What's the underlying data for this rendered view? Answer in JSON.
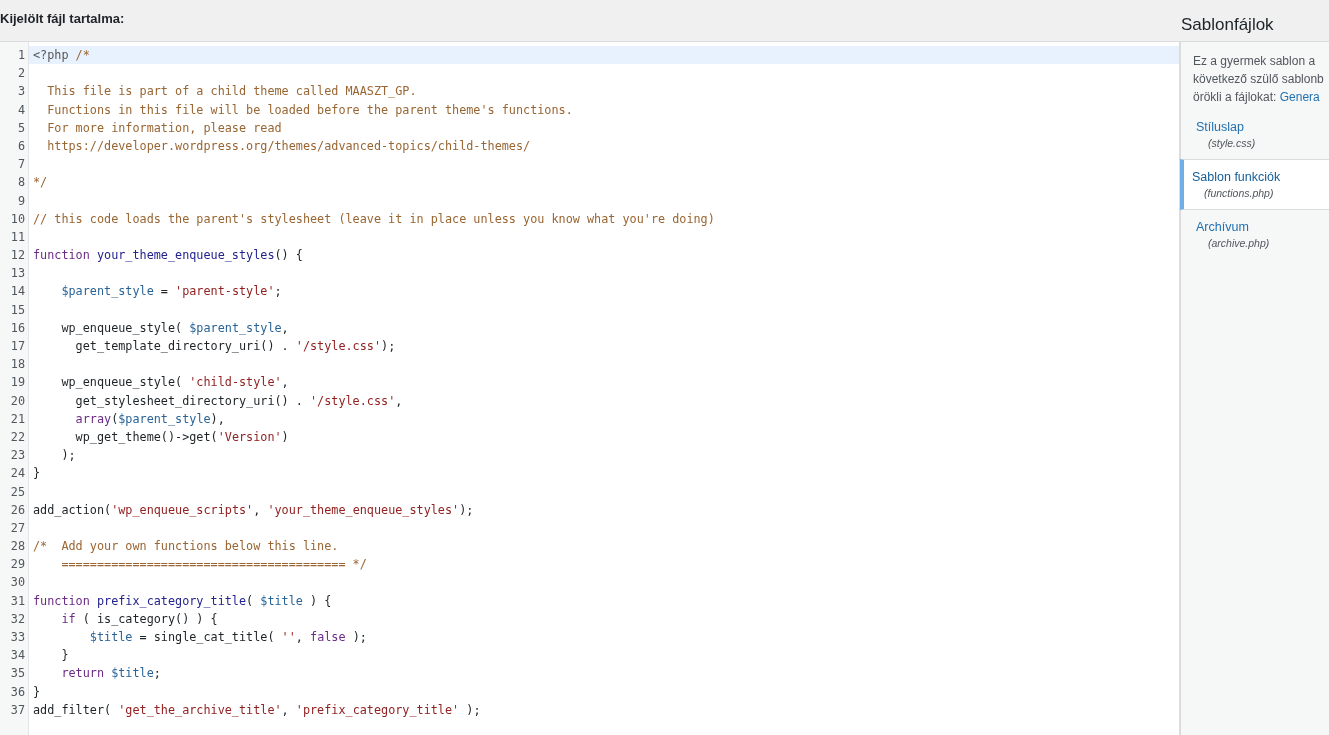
{
  "editor": {
    "label": "Kijelölt fájl tartalma:",
    "lines": [
      {
        "number": "1",
        "current": true,
        "tokens": [
          {
            "kind": "meta",
            "text": "<?php"
          },
          {
            "kind": "comment",
            "text": " /*"
          }
        ]
      },
      {
        "number": "2",
        "current": false
      },
      {
        "number": "3",
        "current": false,
        "tokens": [
          {
            "kind": "comment",
            "text": "  This file is part of a child theme called MAASZT_GP."
          }
        ]
      },
      {
        "number": "4",
        "current": false,
        "tokens": [
          {
            "kind": "comment",
            "text": "  Functions in this file will be loaded before the parent theme's functions."
          }
        ]
      },
      {
        "number": "5",
        "current": false,
        "tokens": [
          {
            "kind": "comment",
            "text": "  For more information, please read"
          }
        ]
      },
      {
        "number": "6",
        "current": false,
        "tokens": [
          {
            "kind": "comment",
            "text": "  https://developer.wordpress.org/themes/advanced-topics/child-themes/"
          }
        ]
      },
      {
        "number": "7",
        "current": false
      },
      {
        "number": "8",
        "current": false,
        "tokens": [
          {
            "kind": "comment",
            "text": "*/"
          }
        ]
      },
      {
        "number": "9",
        "current": false
      },
      {
        "number": "10",
        "current": false,
        "tokens": [
          {
            "kind": "comment",
            "text": "// this code loads the parent's stylesheet (leave it in place unless you know what you're doing)"
          }
        ]
      },
      {
        "number": "11",
        "current": false
      },
      {
        "number": "12",
        "current": false,
        "tokens": [
          {
            "kind": "keyword",
            "text": "function"
          },
          {
            "kind": "def",
            "text": " your_theme_enqueue_styles"
          },
          {
            "kind": "plain",
            "text": "() {"
          }
        ]
      },
      {
        "number": "13",
        "current": false
      },
      {
        "number": "14",
        "current": false,
        "tokens": [
          {
            "kind": "variable",
            "text": "    $parent_style"
          },
          {
            "kind": "plain",
            "text": " = "
          },
          {
            "kind": "string",
            "text": "'parent-style'"
          },
          {
            "kind": "plain",
            "text": ";"
          }
        ]
      },
      {
        "number": "15",
        "current": false
      },
      {
        "number": "16",
        "current": false,
        "tokens": [
          {
            "kind": "plain",
            "text": "    wp_enqueue_style( "
          },
          {
            "kind": "variable",
            "text": "$parent_style"
          },
          {
            "kind": "plain",
            "text": ","
          }
        ]
      },
      {
        "number": "17",
        "current": false,
        "tokens": [
          {
            "kind": "plain",
            "text": "      get_template_directory_uri() . "
          },
          {
            "kind": "string",
            "text": "'/style.css'"
          },
          {
            "kind": "plain",
            "text": ");"
          }
        ]
      },
      {
        "number": "18",
        "current": false
      },
      {
        "number": "19",
        "current": false,
        "tokens": [
          {
            "kind": "plain",
            "text": "    wp_enqueue_style( "
          },
          {
            "kind": "string",
            "text": "'child-style'"
          },
          {
            "kind": "plain",
            "text": ","
          }
        ]
      },
      {
        "number": "20",
        "current": false,
        "tokens": [
          {
            "kind": "plain",
            "text": "      get_stylesheet_directory_uri() . "
          },
          {
            "kind": "string",
            "text": "'/style.css'"
          },
          {
            "kind": "plain",
            "text": ","
          }
        ]
      },
      {
        "number": "21",
        "current": false,
        "tokens": [
          {
            "kind": "keyword",
            "text": "      array"
          },
          {
            "kind": "plain",
            "text": "("
          },
          {
            "kind": "variable",
            "text": "$parent_style"
          },
          {
            "kind": "plain",
            "text": "),"
          }
        ]
      },
      {
        "number": "22",
        "current": false,
        "tokens": [
          {
            "kind": "plain",
            "text": "      wp_get_theme()->get("
          },
          {
            "kind": "string",
            "text": "'Version'"
          },
          {
            "kind": "plain",
            "text": ")"
          }
        ]
      },
      {
        "number": "23",
        "current": false,
        "tokens": [
          {
            "kind": "plain",
            "text": "    );"
          }
        ]
      },
      {
        "number": "24",
        "current": false,
        "tokens": [
          {
            "kind": "plain",
            "text": "}"
          }
        ]
      },
      {
        "number": "25",
        "current": false
      },
      {
        "number": "26",
        "current": false,
        "tokens": [
          {
            "kind": "plain",
            "text": "add_action("
          },
          {
            "kind": "string",
            "text": "'wp_enqueue_scripts'"
          },
          {
            "kind": "plain",
            "text": ", "
          },
          {
            "kind": "string",
            "text": "'your_theme_enqueue_styles'"
          },
          {
            "kind": "plain",
            "text": ");"
          }
        ]
      },
      {
        "number": "27",
        "current": false
      },
      {
        "number": "28",
        "current": false,
        "tokens": [
          {
            "kind": "comment",
            "text": "/*  Add your own functions below this line."
          }
        ]
      },
      {
        "number": "29",
        "current": false,
        "tokens": [
          {
            "kind": "comment",
            "text": "    ======================================== */"
          }
        ]
      },
      {
        "number": "30",
        "current": false
      },
      {
        "number": "31",
        "current": false,
        "tokens": [
          {
            "kind": "keyword",
            "text": "function"
          },
          {
            "kind": "def",
            "text": " prefix_category_title"
          },
          {
            "kind": "plain",
            "text": "( "
          },
          {
            "kind": "variable",
            "text": "$title"
          },
          {
            "kind": "plain",
            "text": " ) {"
          }
        ]
      },
      {
        "number": "32",
        "current": false,
        "tokens": [
          {
            "kind": "keyword",
            "text": "    if"
          },
          {
            "kind": "plain",
            "text": " ( is_category() ) {"
          }
        ]
      },
      {
        "number": "33",
        "current": false,
        "tokens": [
          {
            "kind": "variable",
            "text": "        $title"
          },
          {
            "kind": "plain",
            "text": " = single_cat_title( "
          },
          {
            "kind": "string",
            "text": "''"
          },
          {
            "kind": "plain",
            "text": ", "
          },
          {
            "kind": "keyword",
            "text": "false"
          },
          {
            "kind": "plain",
            "text": " );"
          }
        ]
      },
      {
        "number": "34",
        "current": false,
        "tokens": [
          {
            "kind": "plain",
            "text": "    }"
          }
        ]
      },
      {
        "number": "35",
        "current": false,
        "tokens": [
          {
            "kind": "keyword",
            "text": "    return"
          },
          {
            "kind": "variable",
            "text": " $title"
          },
          {
            "kind": "plain",
            "text": ";"
          }
        ]
      },
      {
        "number": "36",
        "current": false,
        "tokens": [
          {
            "kind": "plain",
            "text": "}"
          }
        ]
      },
      {
        "number": "37",
        "current": false,
        "tokens": [
          {
            "kind": "plain",
            "text": "add_filter( "
          },
          {
            "kind": "string",
            "text": "'get_the_archive_title'"
          },
          {
            "kind": "plain",
            "text": ", "
          },
          {
            "kind": "string",
            "text": "'prefix_category_title'"
          },
          {
            "kind": "plain",
            "text": " );"
          }
        ]
      }
    ]
  },
  "sidebar": {
    "title": "Sablonfájlok",
    "description_lines": [
      "Ez a gyermek sablon a",
      "következő szülő sablonb",
      "örökli a fájlokat:"
    ],
    "parent_link": "Genera",
    "files": [
      {
        "name": "Stíluslap",
        "file": "(style.css)",
        "selected": false
      },
      {
        "name": "Sablon funkciók",
        "file": "(functions.php)",
        "selected": true
      },
      {
        "name": "Archívum",
        "file": "(archive.php)",
        "selected": false
      }
    ]
  }
}
